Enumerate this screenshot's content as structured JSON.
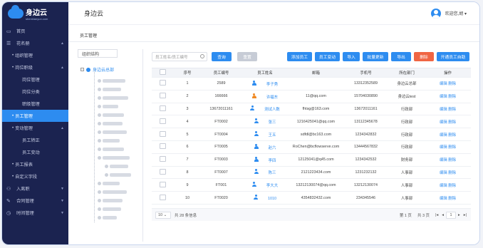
{
  "app": {
    "name": "身边云",
    "sub": "shenbianyun.com"
  },
  "nav": [
    {
      "label": "首页",
      "level": 0,
      "icon": "monitor-icon"
    },
    {
      "label": "花名册",
      "level": 0,
      "icon": "roster-icon",
      "arrow": "▲"
    },
    {
      "label": "组织管理",
      "level": 1
    },
    {
      "label": "岗位职级",
      "level": 1,
      "arrow": "▲"
    },
    {
      "label": "岗位管理",
      "level": 2
    },
    {
      "label": "岗位分类",
      "level": 2
    },
    {
      "label": "职级管理",
      "level": 2
    },
    {
      "label": "员工管理",
      "level": 1,
      "active": true
    },
    {
      "label": "变动管理",
      "level": 1,
      "arrow": "▲"
    },
    {
      "label": "员工转正",
      "level": 2
    },
    {
      "label": "员工变动",
      "level": 2
    },
    {
      "label": "员工报表",
      "level": 1
    },
    {
      "label": "自定义字段",
      "level": 1
    },
    {
      "label": "入离职",
      "level": 0,
      "icon": "person-icon",
      "arrow": "▼"
    },
    {
      "label": "合同管理",
      "level": 0,
      "icon": "contract-icon",
      "arrow": "▼"
    },
    {
      "label": "时间管理",
      "level": 0,
      "icon": "clock-icon",
      "arrow": "▼"
    }
  ],
  "header": {
    "title": "身边云",
    "user": "欢迎您,胡 ▾"
  },
  "tabs": [
    {
      "label": "员工管理"
    }
  ],
  "tree": {
    "header": "组织结构",
    "root": "身边云总部"
  },
  "toolbar": {
    "search_placeholder": "员工姓名/员工编号",
    "query": "查询",
    "reset": "重置",
    "buttons": [
      "添加员工",
      "员工变动",
      "导入",
      "批量更新",
      "导出",
      "删除",
      "开通员工自助"
    ]
  },
  "table": {
    "headers": [
      "",
      "序号",
      "员工编号",
      "员工姓名",
      "邮箱",
      "手机号",
      "所在部门",
      "操作"
    ],
    "rows": [
      {
        "no": "1",
        "id": "2589",
        "name": "李子秀",
        "email": "",
        "phone": "13312352589",
        "dept": "身边云总部",
        "icon_color": "#2d8cf0"
      },
      {
        "no": "2",
        "id": "166666",
        "name": "许福东",
        "email": "11@qq.com",
        "phone": "15704030890",
        "dept": "身边云test",
        "icon_color": "#f08a24"
      },
      {
        "no": "3",
        "id": "13672011161",
        "name": "测试人数",
        "email": "fhtsg@163.com",
        "phone": "13672011161",
        "dept": "行政部",
        "icon_color": "#2d8cf0"
      },
      {
        "no": "4",
        "id": "FT0002",
        "name": "张三",
        "email": "1216425041@qq.com",
        "phone": "13112345678",
        "dept": "行政部",
        "icon_color": "#2d8cf0"
      },
      {
        "no": "5",
        "id": "FT0004",
        "name": "王五",
        "email": "sdfdl@bc163.com",
        "phone": "1234342832",
        "dept": "行政部",
        "icon_color": "#2d8cf0"
      },
      {
        "no": "6",
        "id": "FT0005",
        "name": "赵六",
        "email": "RoChen@bcflowserve.com",
        "phone": "13444567832",
        "dept": "行政部",
        "icon_color": "#2d8cf0"
      },
      {
        "no": "7",
        "id": "FT0003",
        "name": "李四",
        "email": "12125041@q45.com",
        "phone": "1234342532",
        "dept": "财务部",
        "icon_color": "#2d8cf0"
      },
      {
        "no": "8",
        "id": "FT0007",
        "name": "陈三",
        "email": "2121223434.com",
        "phone": "1231232132",
        "dept": "人事部",
        "icon_color": "#2d8cf0"
      },
      {
        "no": "9",
        "id": "FT001",
        "name": "李大大",
        "email": "13212130074@qq.com",
        "phone": "13212130074",
        "dept": "人事部",
        "icon_color": "#2d8cf0"
      },
      {
        "no": "10",
        "id": "FT0020",
        "name": "1010",
        "email": "4354832432.com",
        "phone": "234345546",
        "dept": "人事部",
        "icon_color": "#2d8cf0"
      }
    ],
    "edit": "编辑",
    "delete": "删除"
  },
  "pager": {
    "size": "10",
    "total": "共 28 条信息",
    "page": "第 1 页",
    "pages": "共 3 页",
    "current": "1"
  }
}
